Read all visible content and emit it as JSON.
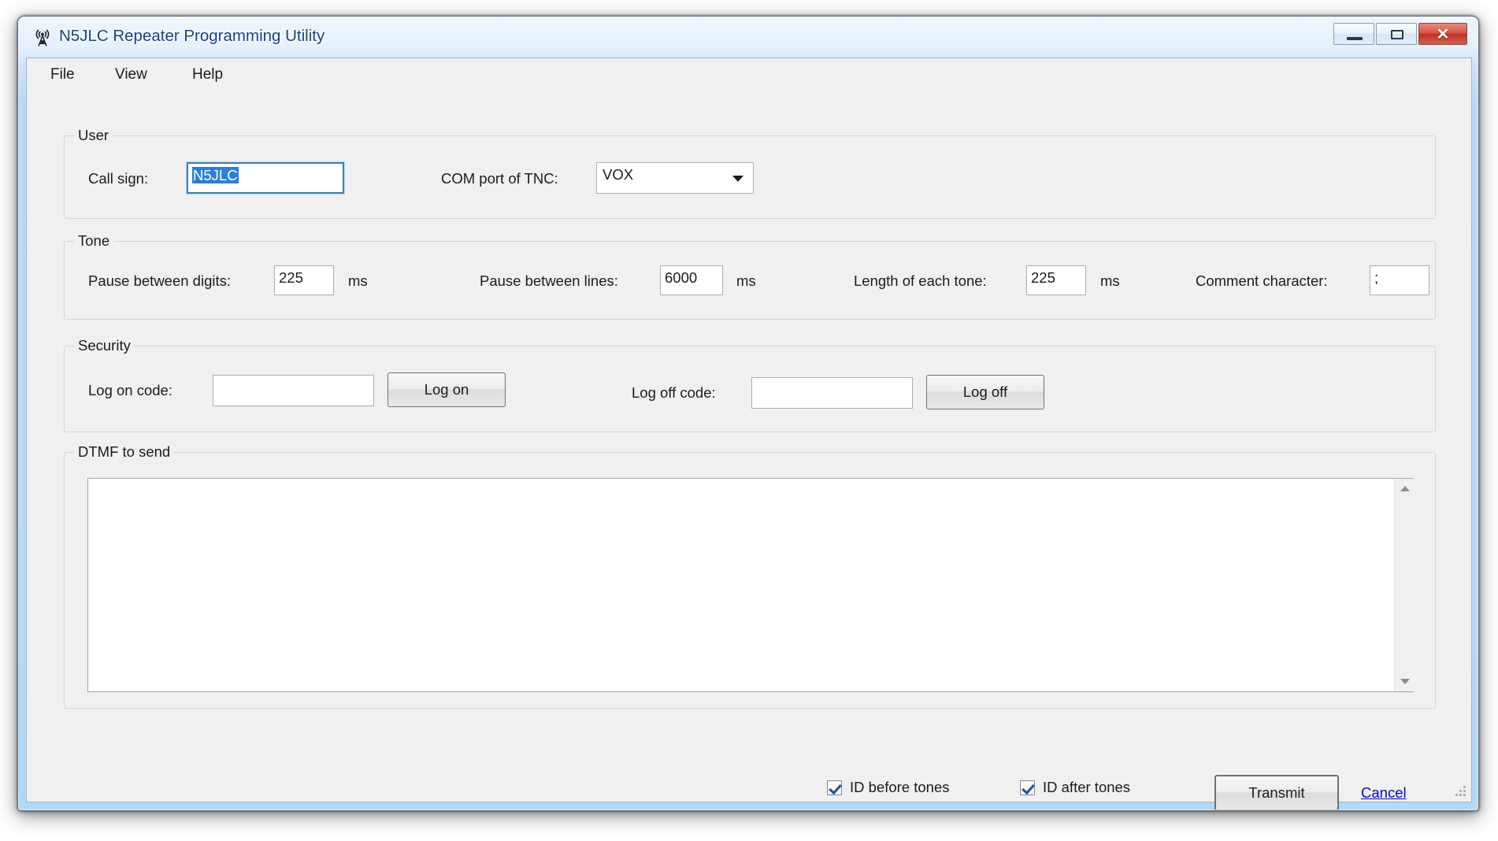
{
  "window": {
    "title": "N5JLC Repeater Programming Utility",
    "icon": "antenna-tower-icon",
    "controls": {
      "minimize": "minimize",
      "maximize": "restore",
      "close": "✕"
    }
  },
  "menubar": {
    "items": [
      {
        "label": "File"
      },
      {
        "label": "View"
      },
      {
        "label": "Help"
      }
    ]
  },
  "groups": {
    "user": {
      "label": "User",
      "callsign_label": "Call sign:",
      "callsign_value": "N5JLC",
      "comport_label": "COM port of TNC:",
      "comport_value": "VOX"
    },
    "tone": {
      "label": "Tone",
      "pause_digits_label": "Pause between digits:",
      "pause_digits_value": "225",
      "pause_digits_unit": "ms",
      "pause_lines_label": "Pause between lines:",
      "pause_lines_value": "6000",
      "pause_lines_unit": "ms",
      "tone_length_label": "Length of each tone:",
      "tone_length_value": "225",
      "tone_length_unit": "ms",
      "comment_char_label": "Comment character:",
      "comment_char_value": ";"
    },
    "security": {
      "label": "Security",
      "logon_code_label": "Log on code:",
      "logon_code_value": "",
      "logon_button": "Log on",
      "logoff_code_label": "Log off code:",
      "logoff_code_value": "",
      "logoff_button": "Log off"
    },
    "dtmf": {
      "label": "DTMF to send",
      "value": ""
    }
  },
  "footer": {
    "id_before_label": "ID before tones",
    "id_before_checked": true,
    "id_after_label": "ID after tones",
    "id_after_checked": true,
    "transmit_button": "Transmit",
    "cancel_link": "Cancel"
  },
  "colors": {
    "title_text": "#15428b",
    "selection": "#2a7fdb",
    "link": "#0000ee",
    "client_bg": "#f0f0f0",
    "close_button": "#bf3124"
  }
}
